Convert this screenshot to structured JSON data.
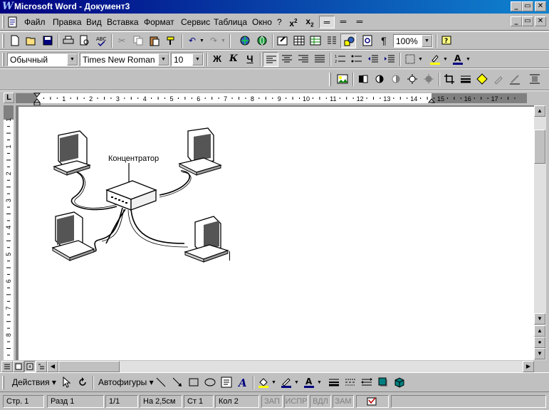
{
  "window": {
    "title": "Microsoft Word - Документ3",
    "controls": {
      "minimize": "_",
      "restore": "▭",
      "close": "✕"
    }
  },
  "menubar": {
    "items": [
      "Файл",
      "Правка",
      "Вид",
      "Вставка",
      "Формат",
      "Сервис",
      "Таблица",
      "Окно",
      "?"
    ]
  },
  "standard_toolbar": {
    "zoom": "100%"
  },
  "formatting_toolbar": {
    "style": "Обычный",
    "font": "Times New Roman",
    "size": "10",
    "bold": "Ж",
    "italic": "К",
    "underline": "Ч"
  },
  "ruler": {
    "h_labels": [
      "1",
      "2",
      "3",
      "4",
      "5",
      "6",
      "7",
      "8",
      "9",
      "10",
      "11",
      "12",
      "13",
      "14",
      "15",
      "16",
      "17"
    ],
    "v_labels": [
      "1",
      "1",
      "2",
      "3",
      "4",
      "5",
      "6",
      "7",
      "8"
    ],
    "corner": "L"
  },
  "document": {
    "figure_label": "Концентратор"
  },
  "drawing_toolbar": {
    "actions": "Действия",
    "autoshapes": "Автофигуры"
  },
  "statusbar": {
    "page": "Стр. 1",
    "section": "Разд 1",
    "pages": "1/1",
    "at": "На 2,5см",
    "line": "Ст 1",
    "col": "Кол 2",
    "rec": "ЗАП",
    "trk": "ИСПР",
    "ext": "ВДЛ",
    "ovr": "ЗАМ"
  },
  "colors": {
    "titlebar_start": "#000080",
    "titlebar_end": "#1084d0",
    "face": "#c0c0c0"
  }
}
